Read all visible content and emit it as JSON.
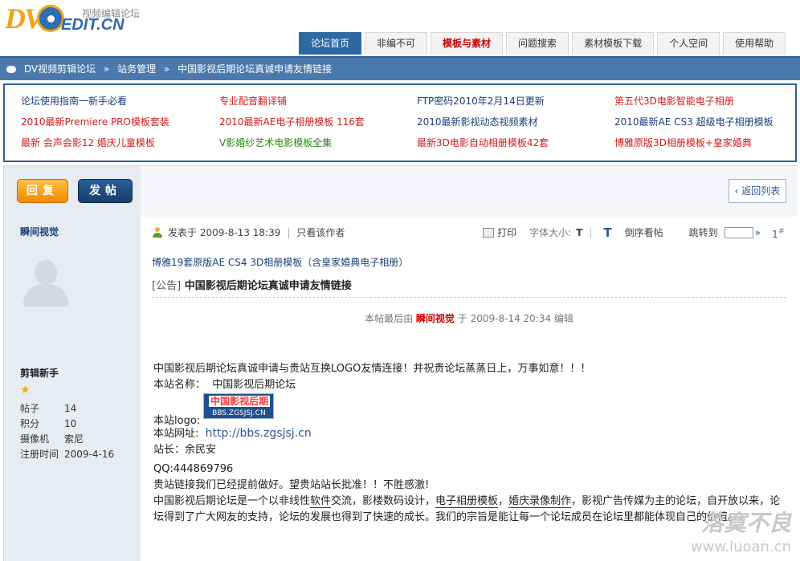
{
  "header": {
    "logo_dv": "DV",
    "logo_edit": "EDIT.CN",
    "logo_sub": "视频编辑论坛",
    "nav": [
      {
        "label": "论坛首页",
        "active": true,
        "red": false
      },
      {
        "label": "非编不可",
        "active": false,
        "red": false
      },
      {
        "label": "模板与素材",
        "active": false,
        "red": true
      },
      {
        "label": "问题搜索",
        "active": false,
        "red": false
      },
      {
        "label": "素材模板下载",
        "active": false,
        "red": false
      },
      {
        "label": "个人空间",
        "active": false,
        "red": false
      },
      {
        "label": "使用帮助",
        "active": false,
        "red": false
      }
    ]
  },
  "breadcrumb": [
    "DV视频剪辑论坛",
    "站务管理",
    "中国影视后期论坛真诚申请友情链接"
  ],
  "links": [
    {
      "text": "论坛使用指南一新手必看",
      "color": "blue"
    },
    {
      "text": "专业配音翻译铺",
      "color": "red"
    },
    {
      "text": "FTP密码2010年2月14日更新",
      "color": "blue"
    },
    {
      "text": "第五代3D电影智能电子相册",
      "color": "red"
    },
    {
      "text": "2010最新Premiere PRO模板套装",
      "color": "red"
    },
    {
      "text": "2010最新AE电子相册模板  116套",
      "color": "red"
    },
    {
      "text": "2010最新影视动态视频素材",
      "color": "blue"
    },
    {
      "text": "2010最新AE CS3 超级电子相册模板",
      "color": "blue"
    },
    {
      "text": "最新 会声会影12 婚庆儿童模板",
      "color": "red"
    },
    {
      "text": "V影婚纱艺术电影模板全集",
      "color": "green"
    },
    {
      "text": "最新3D电影自动相册模板42套",
      "color": "red"
    },
    {
      "text": "博雅原版3D相册模板+皇家婚典",
      "color": "red"
    }
  ],
  "toolbar": {
    "reply": "回复",
    "post": "发帖",
    "back": "返回列表"
  },
  "author": {
    "name": "瞬间视觉",
    "rank": "剪辑新手",
    "stats": [
      {
        "k": "帖子",
        "v": "14"
      },
      {
        "k": "积分",
        "v": "10"
      },
      {
        "k": "摄像机",
        "v": "索尼"
      },
      {
        "k": "注册时间",
        "v": "2009-4-16"
      }
    ]
  },
  "post": {
    "posted_label": "发表于",
    "posted_time": "2009-8-13 18:39",
    "only_author": "只看该作者",
    "print": "打印",
    "font_size_label": "字体大小:",
    "font_t": "T",
    "font_t_big": "T",
    "reverse": "倒序看帖",
    "jump": "跳转到",
    "jump_arrow": "»",
    "floor": "1",
    "floor_sup": "#",
    "ad": "博雅19套原版AE CS4 3D相册模板（含皇家婚典电子相册）",
    "title_tag": "[公告]",
    "title": "中国影视后期论坛真诚申请友情链接",
    "edited_prefix": "本帖最后由",
    "edited_by": "瞬间视觉",
    "edited_mid": "于",
    "edited_time": "2009-8-14 20:34",
    "edited_suffix": "编辑",
    "body": {
      "line1": "中国影视后期论坛真诚申请与贵站互换LOGO友情连接！并祝贵论坛蒸蒸日上，万事如意！！！",
      "site_name_label": "本站名称：",
      "site_name": "中国影视后期论坛",
      "logo_label": "本站logo:",
      "logo_text": "中国影视后期",
      "logo_url": "BBS.ZGSJSJ.CN",
      "url_label": "本站网址:",
      "url": "http://bbs.zgsjsj.cn",
      "admin": "站长：余民安",
      "qq": "QQ:444869796",
      "line_done": "贵站链接我们已经提前做好。望贵站站长批准！！不胜感激!",
      "para_a": "中国影视后期论坛是一个以非线性",
      "para_ul1": "软件",
      "para_b": "交流，影楼数码设计，",
      "para_ul2": "电子相册模板",
      "para_c": "，",
      "para_ul3": "婚庆录像制作",
      "para_d": "，影视广告传媒为主的论坛，自开放以来，论坛得到了广大网友的支持，论坛的发展也得到了快速的成长。我们的宗旨是能让每一个论坛成员在论坛里都能体现自己的价值。"
    }
  },
  "watermark": {
    "line1": "落寞不良",
    "line2": "www.luoan.cn"
  }
}
